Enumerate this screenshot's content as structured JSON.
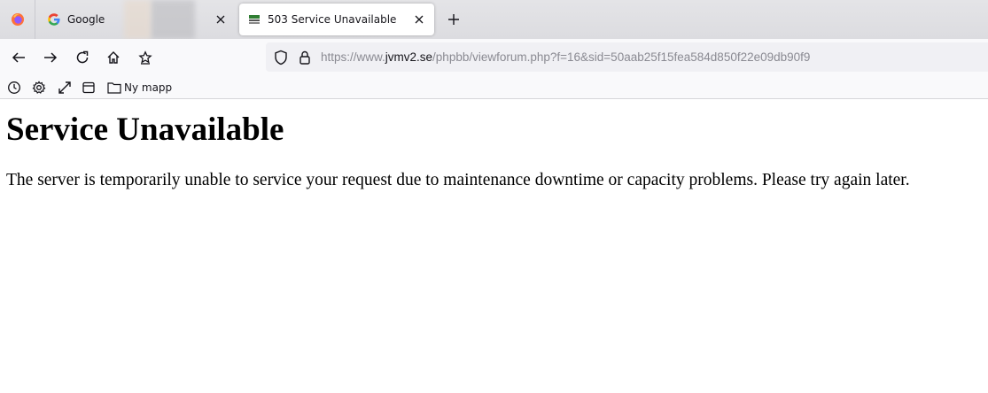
{
  "browser": {
    "tabs": [
      {
        "title": "Google",
        "active": false,
        "favicon": "google-favicon"
      },
      {
        "title": "503 Service Unavailable",
        "active": true,
        "favicon": "jvmv-favicon"
      }
    ],
    "url": {
      "scheme_prefix": "https://www.",
      "host": "jvmv2.se",
      "path": "/phpbb/viewforum.php?f=16&sid=50aab25f15fea584d850f22e09db90f9"
    },
    "bookmarks": [
      {
        "label": "Ny mapp",
        "icon": "folder-icon"
      }
    ],
    "nav_icons": [
      "back-arrow-icon",
      "forward-arrow-icon",
      "reload-icon",
      "home-icon",
      "star-icon"
    ],
    "toolbar_icons": [
      "history-clock-icon",
      "settings-gear-icon",
      "fullscreen-expand-icon",
      "sidebar-icon"
    ]
  },
  "page": {
    "heading": "Service Unavailable",
    "message": "The server is temporarily unable to service your request due to maintenance downtime or capacity problems. Please try again later."
  },
  "colors": {
    "tabstrip_bg": "#e4e4e7",
    "toolbar_bg": "#f9f9fb",
    "urlbar_bg": "#f0f0f4",
    "text": "#15141a",
    "url_muted": "#8a8a92"
  }
}
